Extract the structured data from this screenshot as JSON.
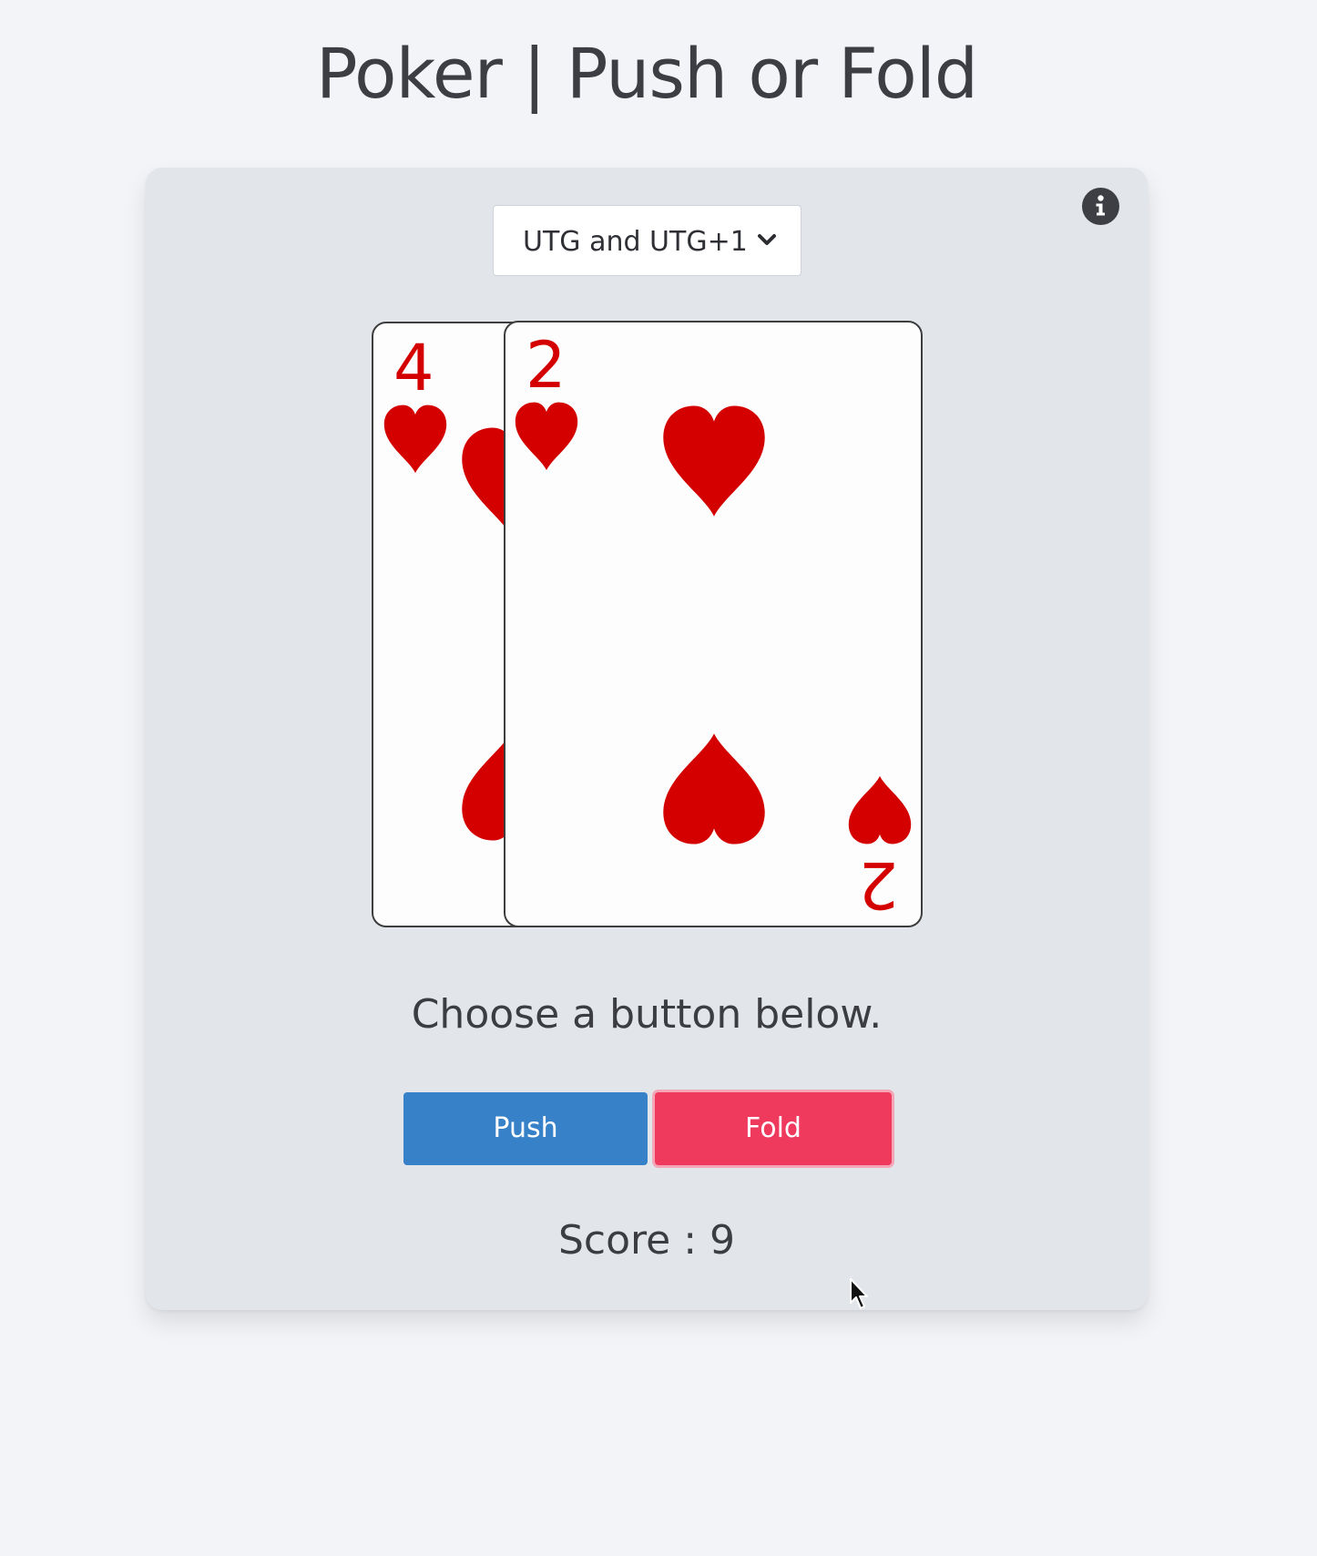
{
  "header": {
    "title": "Poker | Push or Fold"
  },
  "toolbar": {
    "position_select": {
      "selected": "UTG and UTG+1"
    },
    "info_icon": "info-circle-icon"
  },
  "hand": {
    "cards": [
      {
        "rank": "4",
        "suit": "hearts"
      },
      {
        "rank": "2",
        "suit": "hearts"
      }
    ]
  },
  "prompt": "Choose a button below.",
  "actions": {
    "push_label": "Push",
    "fold_label": "Fold"
  },
  "score": {
    "text": "Score : 9",
    "value": 9
  },
  "colors": {
    "background": "#f3f4f8",
    "panel": "#e2e5ea",
    "push": "#3781c8",
    "fold": "#ef3a5d",
    "suit_red": "#d40000"
  }
}
